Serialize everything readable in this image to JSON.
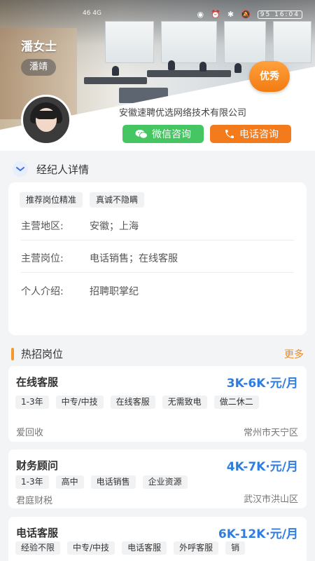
{
  "status_bar": {
    "left_text": "46 4G",
    "right_text": "95 16:04"
  },
  "agent": {
    "name": "潘女士",
    "tag": "潘靖",
    "badge": "优秀",
    "company": "安徽速聘优选网络技术有限公司"
  },
  "actions": {
    "wechat_label": "微信咨询",
    "phone_label": "电话咨询"
  },
  "colors": {
    "wechat": "#45c663",
    "phone": "#f47b1c",
    "salary": "#2f7de0",
    "accent": "#f39a2c"
  },
  "details": {
    "title": "经纪人详情",
    "tags": [
      "推荐岗位精准",
      "真诚不隐瞒"
    ],
    "rows": [
      {
        "key": "主营地区:",
        "value": "安徽；上海"
      },
      {
        "key": "主营岗位:",
        "value": "电话销售；在线客服"
      },
      {
        "key": "个人介绍:",
        "value": "招聘职掌纪"
      }
    ]
  },
  "hot_jobs": {
    "title": "热招岗位",
    "more": "更多",
    "items": [
      {
        "title": "在线客服",
        "salary": "3K-6K·元/月",
        "tags": [
          "1-3年",
          "中专/中技",
          "在线客服",
          "无需致电",
          "做二休二"
        ],
        "company": "爱回收",
        "location": "常州市天宁区"
      },
      {
        "title": "财务顾问",
        "salary": "4K-7K·元/月",
        "tags": [
          "1-3年",
          "高中",
          "电话销售",
          "企业资源"
        ],
        "company": "君庭财税",
        "location": "武汉市洪山区"
      },
      {
        "title": "电话客服",
        "salary": "6K-12K·元/月",
        "tags": [
          "经验不限",
          "中专/中技",
          "电话客服",
          "外呼客服",
          "销"
        ],
        "company": "",
        "location": ""
      }
    ]
  }
}
